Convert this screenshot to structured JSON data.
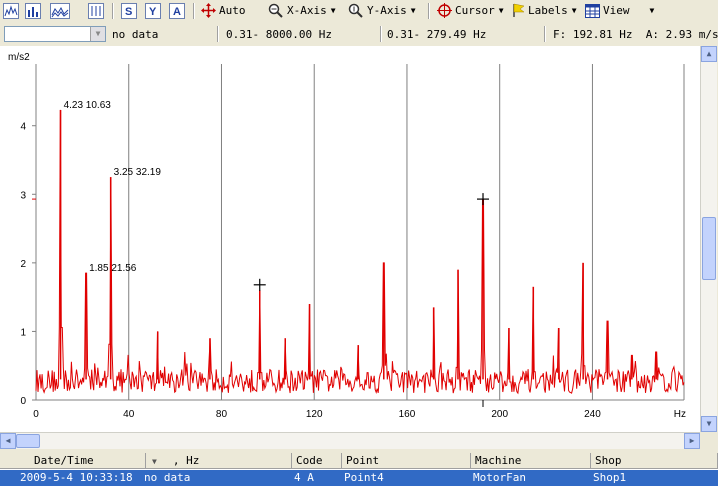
{
  "toolbar": {
    "auto": "Auto",
    "xaxis": "X-Axis",
    "yaxis": "Y-Axis",
    "cursor": "Cursor",
    "labels": "Labels",
    "view": "View",
    "icons": [
      "spectrum-icon",
      "bar-chart-icon",
      "waterfall-icon",
      "trend-icon",
      "s-icon",
      "y-icon",
      "a-icon"
    ]
  },
  "info": {
    "combo_value": "",
    "data_status": "no data",
    "freq_range": "0.31- 8000.00 Hz",
    "view_range": "0.31- 279.49 Hz",
    "cursor_readout": "F: 192.81 Hz  A: 2.93 m/s2"
  },
  "chart_data": {
    "type": "line",
    "ylabel": "m/s2",
    "xlabel": "Hz",
    "xlim": [
      0,
      279.49
    ],
    "ylim": [
      0,
      4.9
    ],
    "xticks": [
      0,
      40,
      80,
      120,
      160,
      200,
      240
    ],
    "yticks": [
      0,
      1,
      2,
      3,
      4
    ],
    "color": "#e00000",
    "grid": true,
    "peaks": [
      {
        "x": 10.6,
        "y": 4.23
      },
      {
        "x": 21.6,
        "y": 1.85
      },
      {
        "x": 32.2,
        "y": 3.25
      },
      {
        "x": 52.5,
        "y": 1.0
      },
      {
        "x": 75.0,
        "y": 0.9
      },
      {
        "x": 96.5,
        "y": 1.6
      },
      {
        "x": 107.5,
        "y": 0.9
      },
      {
        "x": 118.0,
        "y": 1.4
      },
      {
        "x": 139.0,
        "y": 0.8
      },
      {
        "x": 150.0,
        "y": 2.0
      },
      {
        "x": 171.5,
        "y": 1.35
      },
      {
        "x": 182.0,
        "y": 1.9
      },
      {
        "x": 192.8,
        "y": 2.93
      },
      {
        "x": 204.0,
        "y": 1.05
      },
      {
        "x": 214.5,
        "y": 1.65
      },
      {
        "x": 225.5,
        "y": 1.05
      },
      {
        "x": 236.0,
        "y": 2.0
      },
      {
        "x": 246.5,
        "y": 1.15
      },
      {
        "x": 257.0,
        "y": 0.65
      },
      {
        "x": 267.5,
        "y": 0.7
      }
    ],
    "annotations": [
      {
        "x": 10.6,
        "y": 4.23,
        "label": "4.23   10.63"
      },
      {
        "x": 32.2,
        "y": 3.25,
        "label": "3.25   32.19"
      },
      {
        "x": 21.6,
        "y": 1.85,
        "label": "1.85   21.56"
      }
    ],
    "cursors": [
      {
        "x": 96.5,
        "y": 1.68
      },
      {
        "x": 192.8,
        "y": 2.93
      }
    ]
  },
  "table": {
    "headers": [
      "Date/Time",
      ", Hz",
      "Code",
      "Point",
      "Machine",
      "Shop"
    ],
    "rows": [
      [
        "2009-5-4 10:33:18",
        "no data",
        "4 A",
        "Point4",
        "MotorFan",
        "Shop1"
      ]
    ]
  }
}
